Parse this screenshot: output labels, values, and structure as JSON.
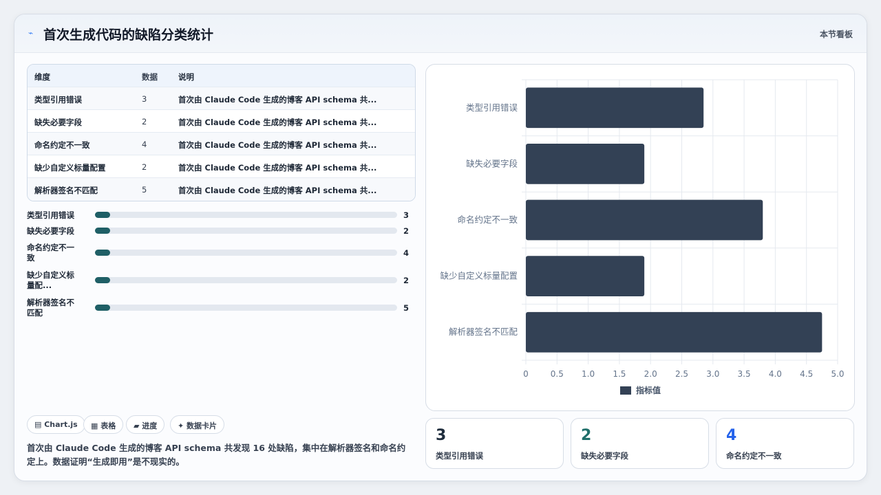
{
  "header": {
    "title": "首次生成代码的缺陷分类统计",
    "badge": "本节看板",
    "icon": "sparkle-icon"
  },
  "table": {
    "headers": [
      "维度",
      "数据",
      "说明"
    ],
    "rows": [
      {
        "name": "类型引用错误",
        "value": "3",
        "desc": "首次由 Claude Code 生成的博客 API schema 共..."
      },
      {
        "name": "缺失必要字段",
        "value": "2",
        "desc": "首次由 Claude Code 生成的博客 API schema 共..."
      },
      {
        "name": "命名约定不一致",
        "value": "4",
        "desc": "首次由 Claude Code 生成的博客 API schema 共..."
      },
      {
        "name": "缺少自定义标量配置",
        "value": "2",
        "desc": "首次由 Claude Code 生成的博客 API schema 共..."
      },
      {
        "name": "解析器签名不匹配",
        "value": "5",
        "desc": "首次由 Claude Code 生成的博客 API schema 共..."
      }
    ]
  },
  "progress": {
    "max": 5,
    "items": [
      {
        "label": "类型引用错误",
        "value": 3,
        "display": "3"
      },
      {
        "label": "缺失必要字段",
        "value": 2,
        "display": "2"
      },
      {
        "label": "命名约定不一致",
        "value": 4,
        "display": "4"
      },
      {
        "label": "缺少自定义标量配...",
        "value": 2,
        "display": "2"
      },
      {
        "label": "解析器签名不匹配",
        "value": 5,
        "display": "5"
      }
    ]
  },
  "chips": [
    "▤ Chart.js",
    "▦ 表格",
    "▰ 进度",
    "✦ 数据卡片"
  ],
  "summary": "首次由 Claude Code 生成的博客 API schema 共发现 16 处缺陷，集中在解析器签名和命名约定上。数据证明“生成即用”是不现实的。",
  "stats": [
    {
      "value": "3",
      "label": "类型引用错误",
      "color": "#1f2d3d"
    },
    {
      "value": "2",
      "label": "缺失必要字段",
      "color": "#1f6f6a"
    },
    {
      "value": "4",
      "label": "命名约定不一致",
      "color": "#2563eb"
    }
  ],
  "chart_data": {
    "type": "bar",
    "orientation": "horizontal",
    "categories": [
      "类型引用错误",
      "缺失必要字段",
      "命名约定不一致",
      "缺少自定义标量配置",
      "解析器签名不匹配"
    ],
    "series": [
      {
        "name": "指标值",
        "values": [
          2.85,
          1.9,
          3.8,
          1.9,
          4.75
        ],
        "color": "#334155"
      }
    ],
    "xlim": [
      0,
      5
    ],
    "xticks": [
      "0",
      "0.5",
      "1.0",
      "1.5",
      "2.0",
      "2.5",
      "3.0",
      "3.5",
      "4.0",
      "4.5",
      "5.0"
    ],
    "grid": true,
    "legend": "bottom"
  }
}
